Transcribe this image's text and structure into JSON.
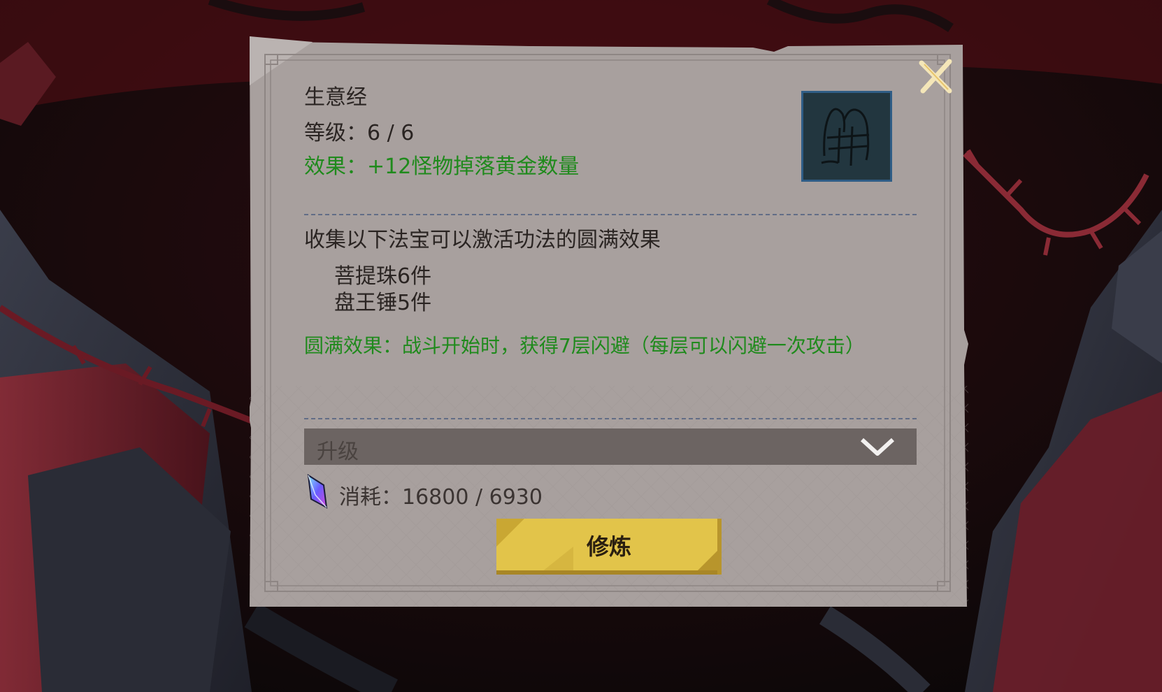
{
  "dialog": {
    "title": "生意经",
    "level_text": "等级：6 / 6",
    "effect_text": "效果：+12怪物掉落黄金数量",
    "skill_icon": "skill-rune-icon",
    "collect_text": "收集以下法宝可以激活功法的圆满效果",
    "requirements": [
      {
        "label": "菩提珠6件"
      },
      {
        "label": "盘王锤5件"
      }
    ],
    "full_effect_text": "圆满效果：战斗开始时，获得7层闪避（每层可以闪避一次攻击）",
    "upgrade": {
      "label": "升级",
      "expanded": false
    },
    "cost": {
      "icon": "crystal-gem-icon",
      "text": "消耗：16800 / 6930"
    },
    "train_button_label": "修炼",
    "close_icon": "close-icon"
  },
  "colors": {
    "panel": "#a8a09e",
    "normal_text": "#2a2422",
    "effect_green": "#1f8a1c",
    "button_gold": "#e2c44a",
    "upgrade_bar": "#6c6462",
    "icon_frame": "#2f5d86"
  }
}
